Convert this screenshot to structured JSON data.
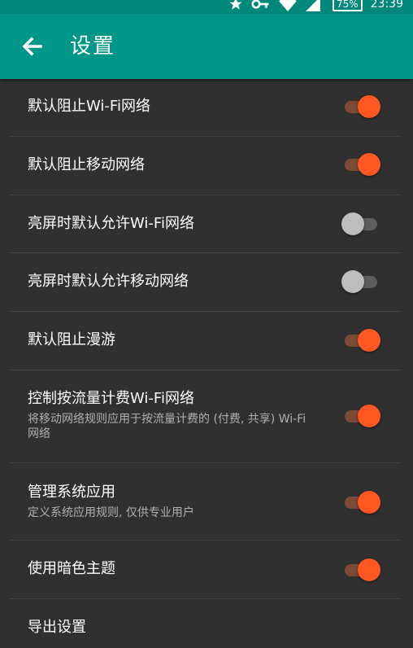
{
  "status_bar": {
    "battery": "75%",
    "time": "23:39",
    "icons": [
      "star-icon",
      "key-icon",
      "wifi-icon",
      "signal-icon",
      "battery-icon"
    ]
  },
  "toolbar": {
    "title": "设置",
    "back_icon": "arrow-left-icon"
  },
  "colors": {
    "toolbar": "#009688",
    "status_bar": "#00897b",
    "background": "#303030",
    "accent": "#ff5722"
  },
  "settings": [
    {
      "title": "默认阻止Wi-Fi网络",
      "summary": "",
      "checked": true
    },
    {
      "title": "默认阻止移动网络",
      "summary": "",
      "checked": true
    },
    {
      "title": "亮屏时默认允许Wi-Fi网络",
      "summary": "",
      "checked": false
    },
    {
      "title": "亮屏时默认允许移动网络",
      "summary": "",
      "checked": false
    },
    {
      "title": "默认阻止漫游",
      "summary": "",
      "checked": true
    },
    {
      "title": "控制按流量计费Wi-Fi网络",
      "summary": "将移动网络规则应用于按流量计费的 (付费, 共享) Wi-Fi网络",
      "checked": true
    },
    {
      "title": "管理系统应用",
      "summary": "定义系统应用规则, 仅供专业用户",
      "checked": true
    },
    {
      "title": "使用暗色主题",
      "summary": "",
      "checked": true
    },
    {
      "title": "导出设置",
      "summary": ""
    }
  ]
}
